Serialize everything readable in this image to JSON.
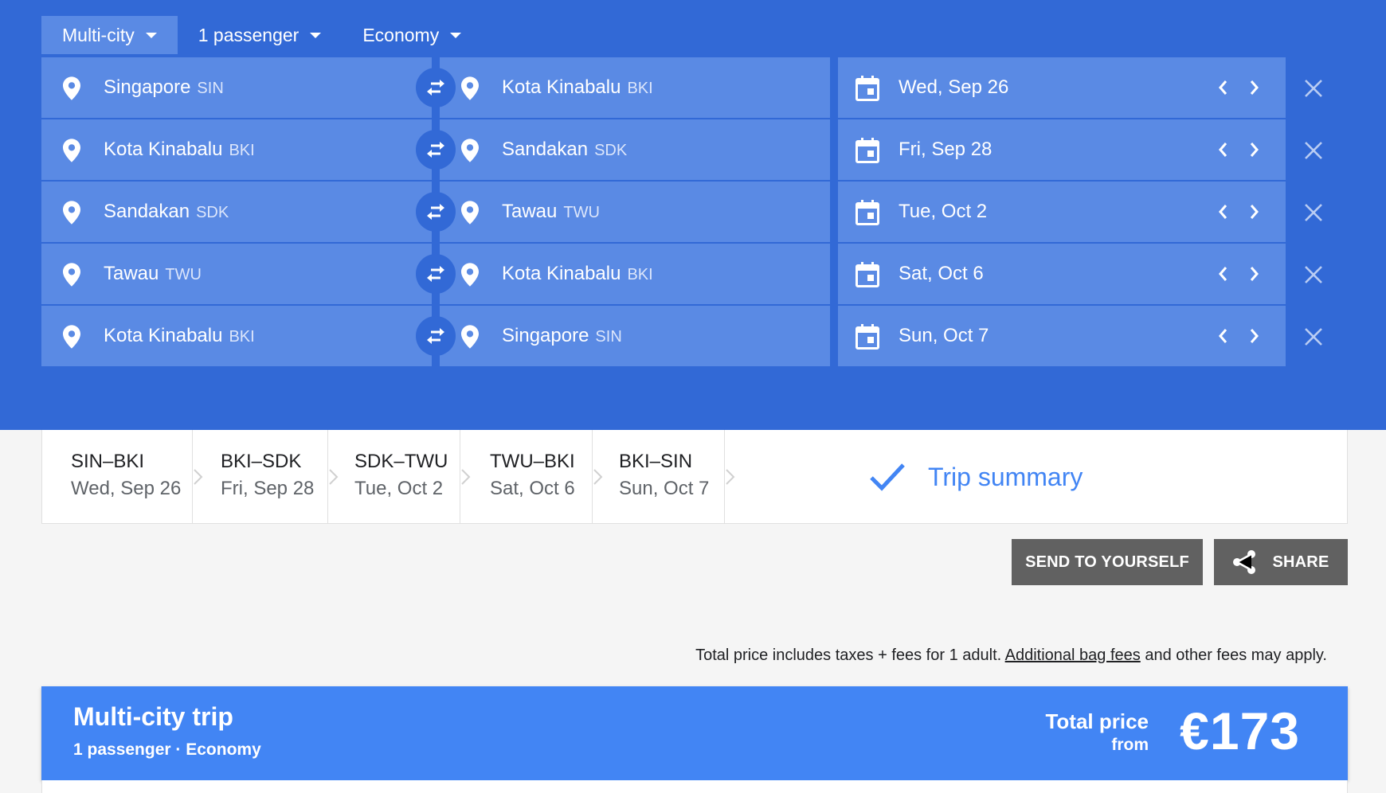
{
  "options": {
    "trip_type": "Multi-city",
    "passengers": "1 passenger",
    "cabin": "Economy"
  },
  "legs": [
    {
      "origin_city": "Singapore",
      "origin_code": "SIN",
      "dest_city": "Kota Kinabalu",
      "dest_code": "BKI",
      "date": "Wed, Sep 26"
    },
    {
      "origin_city": "Kota Kinabalu",
      "origin_code": "BKI",
      "dest_city": "Sandakan",
      "dest_code": "SDK",
      "date": "Fri, Sep 28"
    },
    {
      "origin_city": "Sandakan",
      "origin_code": "SDK",
      "dest_city": "Tawau",
      "dest_code": "TWU",
      "date": "Tue, Oct 2"
    },
    {
      "origin_city": "Tawau",
      "origin_code": "TWU",
      "dest_city": "Kota Kinabalu",
      "dest_code": "BKI",
      "date": "Sat, Oct 6"
    },
    {
      "origin_city": "Kota Kinabalu",
      "origin_code": "BKI",
      "dest_city": "Singapore",
      "dest_code": "SIN",
      "date": "Sun, Oct 7"
    }
  ],
  "tabs": [
    {
      "route": "SIN–BKI",
      "date": "Wed, Sep 26"
    },
    {
      "route": "BKI–SDK",
      "date": "Fri, Sep 28"
    },
    {
      "route": "SDK–TWU",
      "date": "Tue, Oct 2"
    },
    {
      "route": "TWU–BKI",
      "date": "Sat, Oct 6"
    },
    {
      "route": "BKI–SIN",
      "date": "Sun, Oct 7"
    }
  ],
  "summary_tab": {
    "label": "Trip summary"
  },
  "actions": {
    "send_label": "SEND TO YOURSELF",
    "share_label": "SHARE"
  },
  "disclaimer": {
    "before": "Total price includes taxes + fees for 1 adult. ",
    "link": "Additional bag fees",
    "after": " and other fees may apply."
  },
  "trip": {
    "title": "Multi-city trip",
    "subtitle": "1 passenger · Economy",
    "total_label": "Total price",
    "from_label": "from",
    "price": "€173"
  },
  "icons": {
    "location": "location-pin-icon",
    "calendar": "calendar-icon",
    "swap": "swap-arrows-icon",
    "close": "close-icon",
    "check": "checkmark-icon",
    "share": "share-icon"
  },
  "colors": {
    "panel_bg": "#3269d6",
    "field_bg": "#5a8ae4",
    "accent": "#4285f4",
    "button_bg": "#616161"
  }
}
